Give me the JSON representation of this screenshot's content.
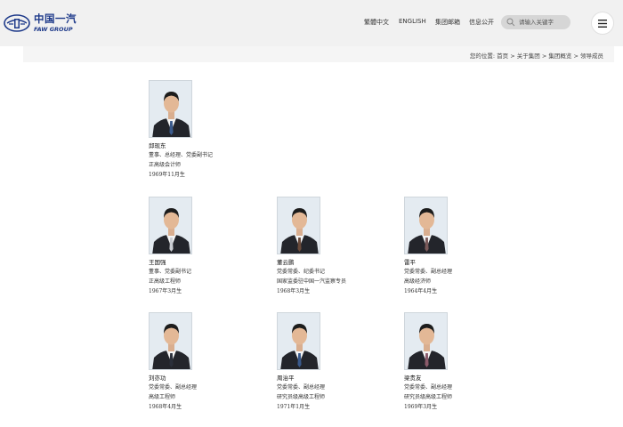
{
  "header": {
    "logo_cn": "中国一汽",
    "logo_en": "FAW GROUP",
    "nav": {
      "traditional": "繁體中文",
      "english": "ENGLISH",
      "mail": "集团邮箱",
      "info": "信息公开"
    },
    "search": {
      "placeholder": "请输入关键字"
    },
    "icons": {
      "search": "search-icon",
      "menu": "hamburger-menu-icon",
      "logo": "faw-emblem-icon"
    }
  },
  "breadcrumb": {
    "prefix": "您的位置:",
    "items": [
      "首页",
      "关于集团",
      "集团概览",
      "领导成员"
    ],
    "separator": ">"
  },
  "colors": {
    "brand": "#1e3a8a",
    "header_bg": "#f1f1f1",
    "photo_bg": "#dfe7ee"
  },
  "leaders": [
    {
      "name": "邱现东",
      "title": "董事、总经理、党委副书记",
      "rank": "正高级会计师",
      "born": "1969年11月生",
      "tie": "#3a5a8c"
    },
    {
      "name": "王国强",
      "title": "董事、党委副书记",
      "rank": "正高级工程师",
      "born": "1967年3月生",
      "tie": "#c9ccd2"
    },
    {
      "name": "董云鹏",
      "title": "党委常委、纪委书记",
      "rank": "国家监委驻中国一汽监察专员",
      "born": "1968年3月生",
      "tie": "#6a4a3a"
    },
    {
      "name": "雷平",
      "title": "党委常委、副总经理",
      "rank": "高级经济师",
      "born": "1964年4月生",
      "tie": "#7a5a5a"
    },
    {
      "name": "刘亦功",
      "title": "党委常委、副总经理",
      "rank": "高级工程师",
      "born": "1968年4月生",
      "tie": "#2a2f3a"
    },
    {
      "name": "周治平",
      "title": "党委常委、副总经理",
      "rank": "研究员级高级工程师",
      "born": "1971年1月生",
      "tie": "#3a5a8c"
    },
    {
      "name": "梁贵友",
      "title": "党委常委、副总经理",
      "rank": "研究员级高级工程师",
      "born": "1969年3月生",
      "tie": "#8a5a6a"
    }
  ]
}
